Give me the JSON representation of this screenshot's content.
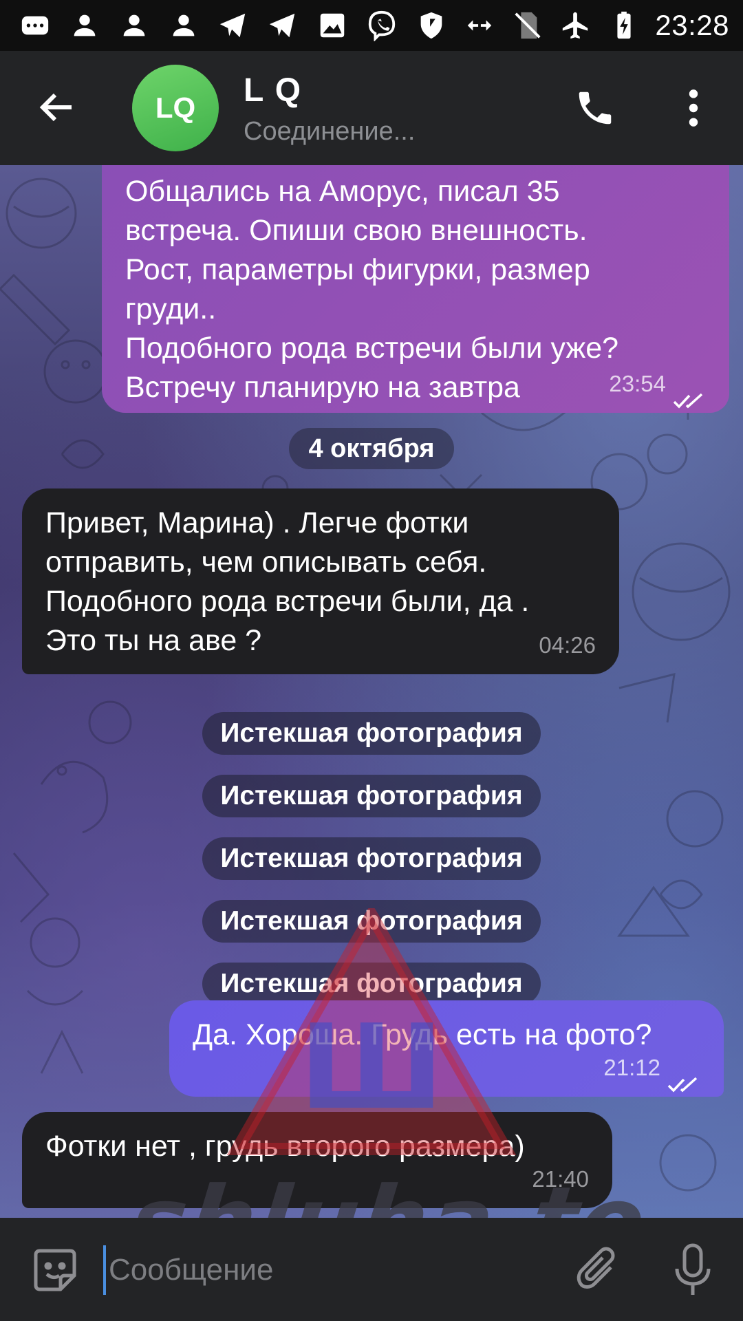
{
  "status_bar": {
    "time": "23:28",
    "icons": [
      "message-icon",
      "person-icon",
      "person-icon",
      "person-icon",
      "telegram-icon",
      "telegram-icon",
      "image-icon",
      "viber-icon",
      "shield-icon",
      "data-arrows-icon",
      "no-sim-icon",
      "airplane-icon",
      "battery-charging-icon"
    ]
  },
  "header": {
    "avatar_initials": "LQ",
    "contact_name": "L Q",
    "status": "Соединение...",
    "avatar_color": "#4fbf55"
  },
  "messages": {
    "out1": {
      "text": "Общались на Аморус, писал 35\nвстреча. Опиши свою внешность.\nРост, параметры фигурки, размер\nгруди..\nПодобного рода встречи были уже?\nВстречу планирую на завтра",
      "time": "23:54"
    },
    "date_separator": "4 октября",
    "in1": {
      "text": "Привет, Марина) . Легче фотки\nотправить, чем описывать себя.\nПодобного рода встречи были, да .\nЭто ты на аве ?",
      "time": "04:26"
    },
    "expired": [
      "Истекшая фотография",
      "Истекшая фотография",
      "Истекшая фотография",
      "Истекшая фотография",
      "Истекшая фотография"
    ],
    "out2": {
      "text": "Да. Хороша. Грудь есть на фото?",
      "time": "21:12"
    },
    "in2": {
      "text": "Фотки нет , грудь второго размера)",
      "time": "21:40"
    }
  },
  "input": {
    "placeholder": "Сообщение"
  },
  "watermark": {
    "text": "shluha.to",
    "logo_letter": "Ш"
  },
  "colors": {
    "outgoing_bubble": "#9351b5",
    "outgoing_bubble_2": "#6d5de3",
    "incoming_bubble": "#1f1f22",
    "header_bg": "#232426"
  }
}
